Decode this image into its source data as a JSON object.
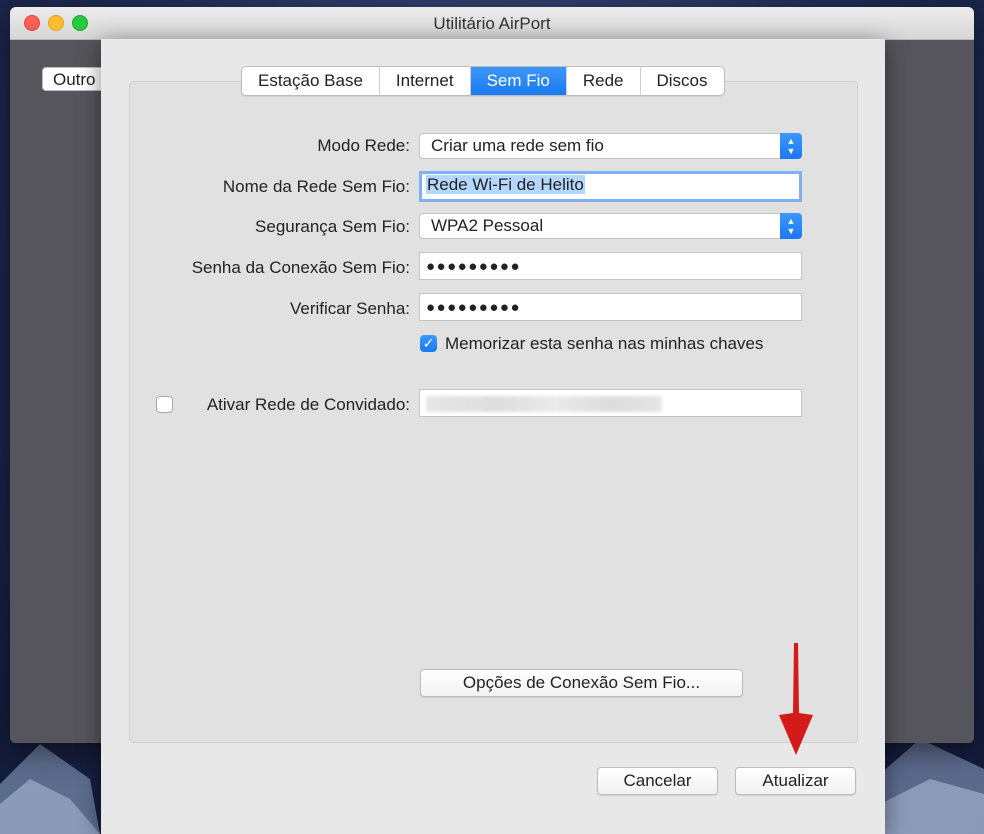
{
  "window": {
    "title": "Utilitário AirPort"
  },
  "background_button": {
    "label": "Outro"
  },
  "tabs": [
    {
      "label": "Estação Base",
      "active": false
    },
    {
      "label": "Internet",
      "active": false
    },
    {
      "label": "Sem Fio",
      "active": true
    },
    {
      "label": "Rede",
      "active": false
    },
    {
      "label": "Discos",
      "active": false
    }
  ],
  "form": {
    "network_mode": {
      "label": "Modo Rede:",
      "value": "Criar uma rede sem fio"
    },
    "network_name": {
      "label": "Nome da Rede Sem Fio:",
      "value": "Rede Wi-Fi de Helito"
    },
    "security": {
      "label": "Segurança Sem Fio:",
      "value": "WPA2 Pessoal"
    },
    "password": {
      "label": "Senha da Conexão Sem Fio:",
      "value": "●●●●●●●●●"
    },
    "verify_password": {
      "label": "Verificar Senha:",
      "value": "●●●●●●●●●"
    },
    "remember": {
      "label": "Memorizar esta senha nas minhas chaves",
      "checked": true
    },
    "guest_network": {
      "label": "Ativar Rede de Convidado:",
      "checked": false
    }
  },
  "buttons": {
    "wireless_options": "Opções de Conexão Sem Fio...",
    "cancel": "Cancelar",
    "update": "Atualizar"
  },
  "icons": {
    "checkmark": "checkmark-icon",
    "stepper": "popup-stepper-icon",
    "annotation_arrow": "red-down-arrow-icon"
  },
  "colors": {
    "accent": "#1b79f2",
    "arrow": "#d51a1a"
  }
}
